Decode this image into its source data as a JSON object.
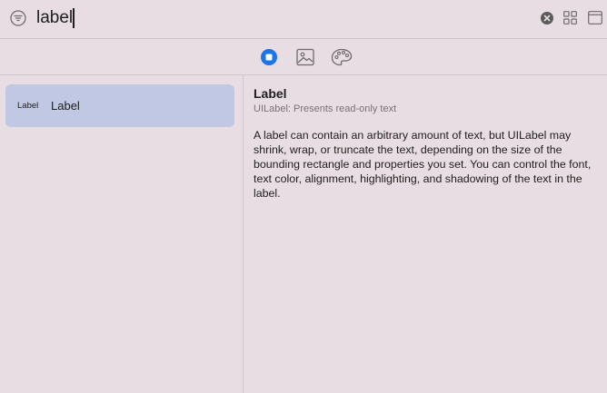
{
  "search": {
    "value": "label",
    "placeholder": ""
  },
  "toolbar": {
    "buttons": [
      {
        "icon": "stop-circle-icon",
        "selected": true
      },
      {
        "icon": "image-icon",
        "selected": false
      },
      {
        "icon": "palette-icon",
        "selected": false
      }
    ]
  },
  "list": {
    "items": [
      {
        "preview": "Label",
        "title": "Label",
        "selected": true
      }
    ]
  },
  "detail": {
    "title": "Label",
    "subtitle": "UILabel: Presents read-only text",
    "body": "A label can contain an arbitrary amount of text, but UILabel may shrink, wrap, or truncate the text, depending on the size of the bounding rectangle and properties you set. You can control the font, text color, alignment, highlighting, and shadowing of the text in the label."
  },
  "colors": {
    "background": "#e8dde2",
    "selection": "#c0c8e4",
    "accent": "#1a73e8",
    "icon": "#6e6a6c"
  }
}
